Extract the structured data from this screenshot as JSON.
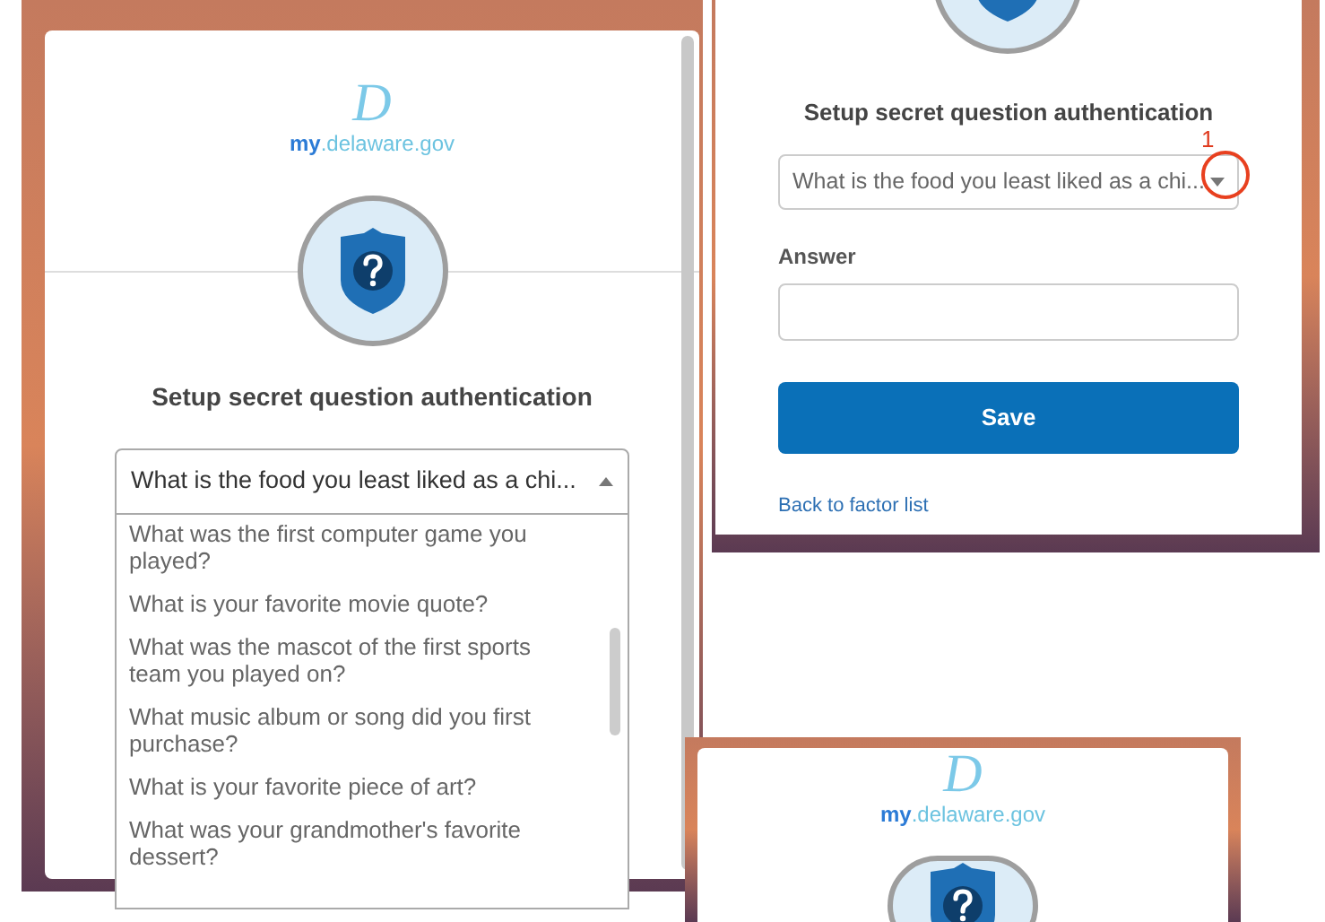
{
  "panels": [
    {
      "kind": "dropdown_open",
      "logo": {
        "letter": "D",
        "prefix": "my",
        "suffix": ".delaware.gov"
      },
      "heading": "Setup secret question authentication",
      "select": {
        "value": "What is the food you least liked as a chi...",
        "expanded": true
      },
      "options": [
        {
          "label": "What was the first computer game you played?"
        },
        {
          "label": "What is your favorite movie quote?"
        },
        {
          "label": "What was the mascot of the first sports team you played on?"
        },
        {
          "label": "What music album or song did you first purchase?"
        },
        {
          "label": "What is your favorite piece of art?"
        },
        {
          "label": "What was your grandmother's favorite dessert?"
        }
      ]
    },
    {
      "kind": "form",
      "heading": "Setup secret question authentication",
      "select": {
        "value": "What is the food you least liked as a chi...",
        "expanded": false
      },
      "annotation": "1",
      "answer_label": "Answer",
      "save": "Save",
      "back_link": "Back to factor list"
    },
    {
      "kind": "logo_only",
      "logo": {
        "letter": "D",
        "prefix": "my",
        "suffix": ".delaware.gov"
      }
    }
  ]
}
